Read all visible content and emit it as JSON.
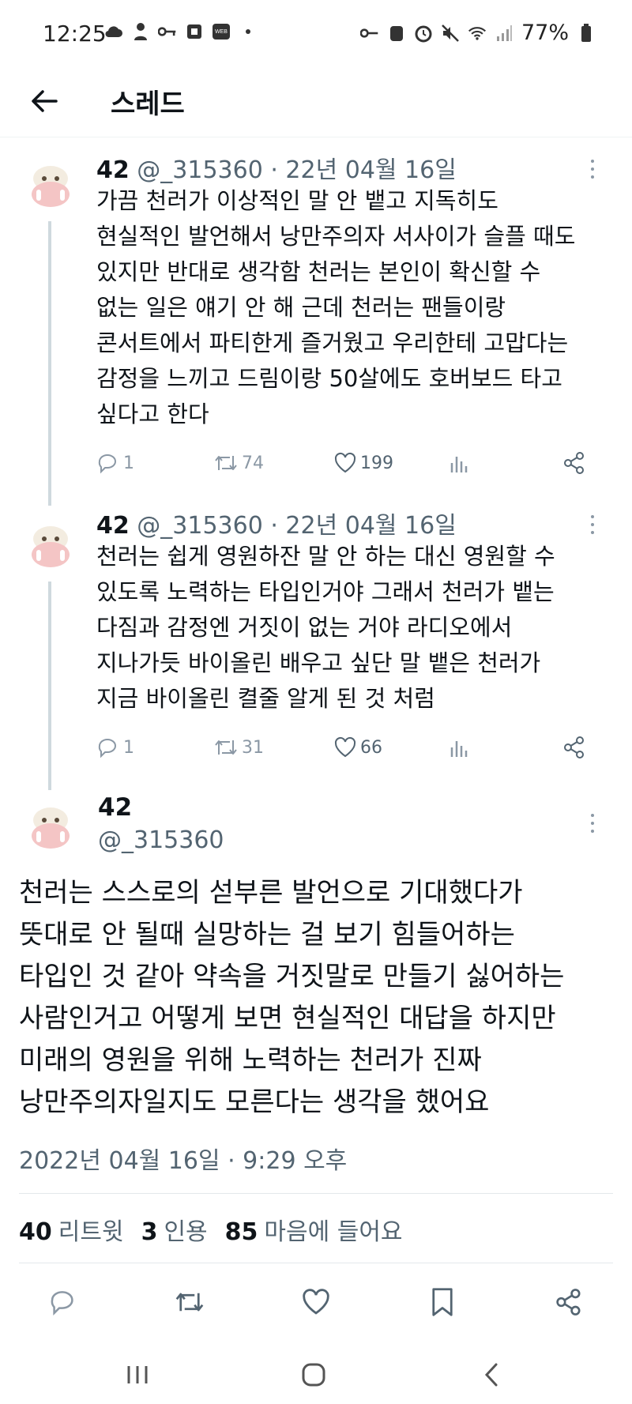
{
  "status_bar": {
    "time": "12:25",
    "battery": "77%",
    "left_icons": [
      "cloud-icon",
      "person-icon",
      "key-icon",
      "square-icon",
      "webtoon-icon",
      "dot-icon"
    ],
    "right_icons": [
      "vpn-key-icon",
      "alarm-icon",
      "alarm-clock-icon",
      "mute-icon",
      "wifi-icon",
      "signal-icon",
      "battery-icon"
    ]
  },
  "header": {
    "title": "스레드"
  },
  "tweets": [
    {
      "name": "42",
      "meta": "@_315360 · 22년 04월 16일",
      "body": "가끔 천러가 이상적인 말 안 뱉고 지독히도\n현실적인 발언해서 낭만주의자 서사이가 슬플 때도\n있지만 반대로 생각함 천러는 본인이 확신할 수\n없는 일은 얘기 안 해 근데 천러는 팬들이랑\n콘서트에서 파티한게 즐거웠고 우리한테 고맙다는\n감정을 느끼고 드림이랑 50살에도 호버보드 타고\n싶다고 한다",
      "replies": "1",
      "retweets": "74",
      "likes": "199"
    },
    {
      "name": "42",
      "meta": "@_315360 · 22년 04월 16일",
      "body": "천러는 쉽게 영원하잔 말 안 하는 대신 영원할 수\n있도록 노력하는 타입인거야 그래서 천러가 뱉는\n다짐과 감정엔 거짓이 없는 거야 라디오에서\n지나가듯 바이올린 배우고 싶단 말 뱉은 천러가\n지금 바이올린 켤줄 알게 된 것 처럼",
      "replies": "1",
      "retweets": "31",
      "likes": "66"
    }
  ],
  "main_tweet": {
    "name": "42",
    "handle": "@_315360",
    "body": "천러는 스스로의 섣부른 발언으로 기대했다가\n뜻대로 안 될때 실망하는 걸 보기 힘들어하는\n타입인 것 같아 약속을 거짓말로 만들기 싫어하는\n사람인거고 어떻게 보면 현실적인 대답을 하지만\n미래의 영원을 위해 노력하는 천러가 진짜\n낭만주의자일지도 모른다는 생각을 했어요",
    "timestamp": "2022년 04월 16일 · 9:29 오후",
    "stats": {
      "retweets_num": "40",
      "retweets_label": "리트윗",
      "quotes_num": "3",
      "quotes_label": "인용",
      "likes_num": "85",
      "likes_label": "마음에 들어요"
    }
  },
  "colors": {
    "text": "#0f1419",
    "secondary": "#536471",
    "icon": "#8b98a5",
    "thread_line": "#cfd9de"
  }
}
